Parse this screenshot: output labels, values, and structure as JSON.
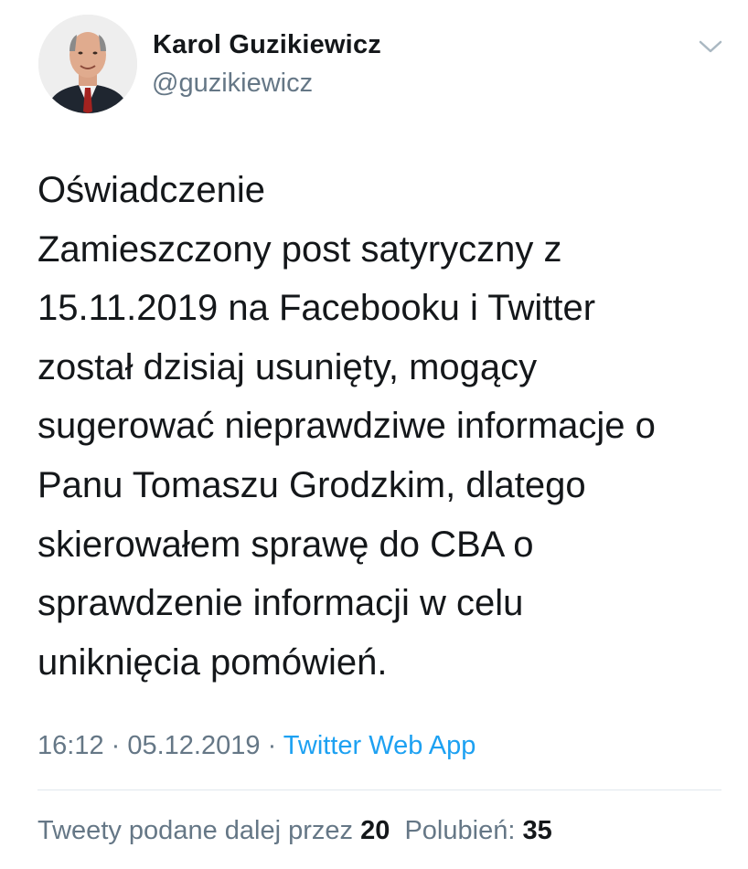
{
  "author": {
    "name": "Karol Guzikiewicz",
    "handle": "@guzikiewicz"
  },
  "header": {
    "menu_icon": "chevron-down-icon"
  },
  "tweet": {
    "text": "Oświadczenie\nZamieszczony post satyryczny z\n15.11.2019 na Facebooku i Twitter\nzostał dzisiaj usunięty, mogący\nsugerować nieprawdziwe informacje  o\nPanu Tomaszu Grodzkim, dlatego\nskierowałem sprawę do CBA o\nsprawdzenie informacji w celu\nuniknięcia pomówień."
  },
  "meta": {
    "time": "16:12",
    "separator1": " · ",
    "date": "05.12.2019",
    "separator2": " · ",
    "source": "Twitter Web App"
  },
  "stats": {
    "retweets_label": "Tweety podane dalej przez",
    "retweets_count": "20",
    "likes_label": "Polubień:",
    "likes_count": "35"
  },
  "colors": {
    "text": "#14171a",
    "secondary": "#657786",
    "link": "#1da1f2",
    "divider": "#e1e8ed"
  }
}
